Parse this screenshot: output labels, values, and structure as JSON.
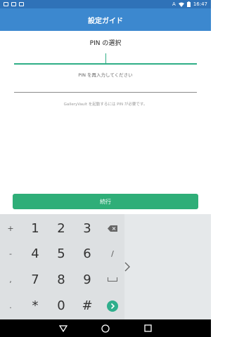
{
  "status": {
    "time": "16:47",
    "keyboard_indicator": "A",
    "icons": [
      "photo-icon",
      "image-icon",
      "document-icon",
      "wifi-icon",
      "battery-icon"
    ]
  },
  "app_bar": {
    "title": "設定ガイド"
  },
  "pin": {
    "title": "PIN の選択",
    "reenter_label": "PIN を再入力してください",
    "info": "GalleryVault を起動するには PIN が必要です。"
  },
  "continue_button": {
    "label": "続行"
  },
  "colors": {
    "status_bar": "#2f72b8",
    "app_bar": "#3c88cf",
    "accent": "#2fae86",
    "button": "#2fae78"
  },
  "keypad": {
    "left_symbols": [
      "+",
      "-",
      ",",
      "."
    ],
    "rows": [
      [
        "1",
        "2",
        "3"
      ],
      [
        "4",
        "5",
        "6"
      ],
      [
        "7",
        "8",
        "9"
      ],
      [
        "*",
        "0",
        "#"
      ]
    ],
    "right_keys": [
      "backspace-icon",
      "/",
      "space-icon",
      "enter-icon"
    ]
  },
  "navigation": {
    "buttons": [
      "back-icon",
      "home-icon",
      "recents-icon"
    ]
  }
}
